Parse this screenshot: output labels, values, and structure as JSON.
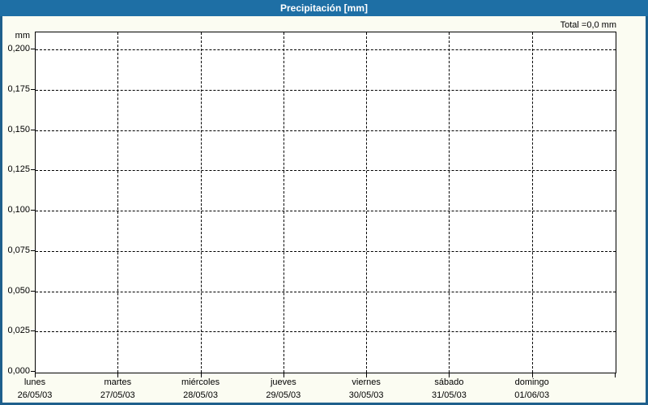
{
  "window": {
    "title": "Precipitación [mm]"
  },
  "summary": {
    "total_label": "Total =0,0 mm",
    "total_value_mm": "0,0"
  },
  "chart_data": {
    "type": "line",
    "title": "Precipitación [mm]",
    "ylabel_unit": "mm",
    "ylim": [
      0,
      0.2
    ],
    "ytick_interval": 0.025,
    "ytick_labels": [
      "0,200",
      "0,175",
      "0,150",
      "0,125",
      "0,100",
      "0,075",
      "0,050",
      "0,025",
      "0,000"
    ],
    "grid": true,
    "legend_position": "none",
    "days": [
      {
        "weekday": "lunes",
        "date": "26/05/03"
      },
      {
        "weekday": "martes",
        "date": "27/05/03"
      },
      {
        "weekday": "miércoles",
        "date": "28/05/03"
      },
      {
        "weekday": "jueves",
        "date": "29/05/03"
      },
      {
        "weekday": "viernes",
        "date": "30/05/03"
      },
      {
        "weekday": "sábado",
        "date": "31/05/03"
      },
      {
        "weekday": "domingo",
        "date": "01/06/03"
      }
    ],
    "series": [
      {
        "name": "Precipitación",
        "unit": "mm",
        "values": [
          0,
          0,
          0,
          0,
          0,
          0,
          0
        ]
      }
    ],
    "total_mm": 0.0,
    "colors": {
      "titlebar_bg": "#1e6fa5",
      "titlebar_text": "#ffffff",
      "frame_border": "#1e5f8c",
      "background": "#fbfcf2",
      "plot_bg": "#ffffff",
      "grid": "#000000",
      "text": "#000000"
    }
  }
}
